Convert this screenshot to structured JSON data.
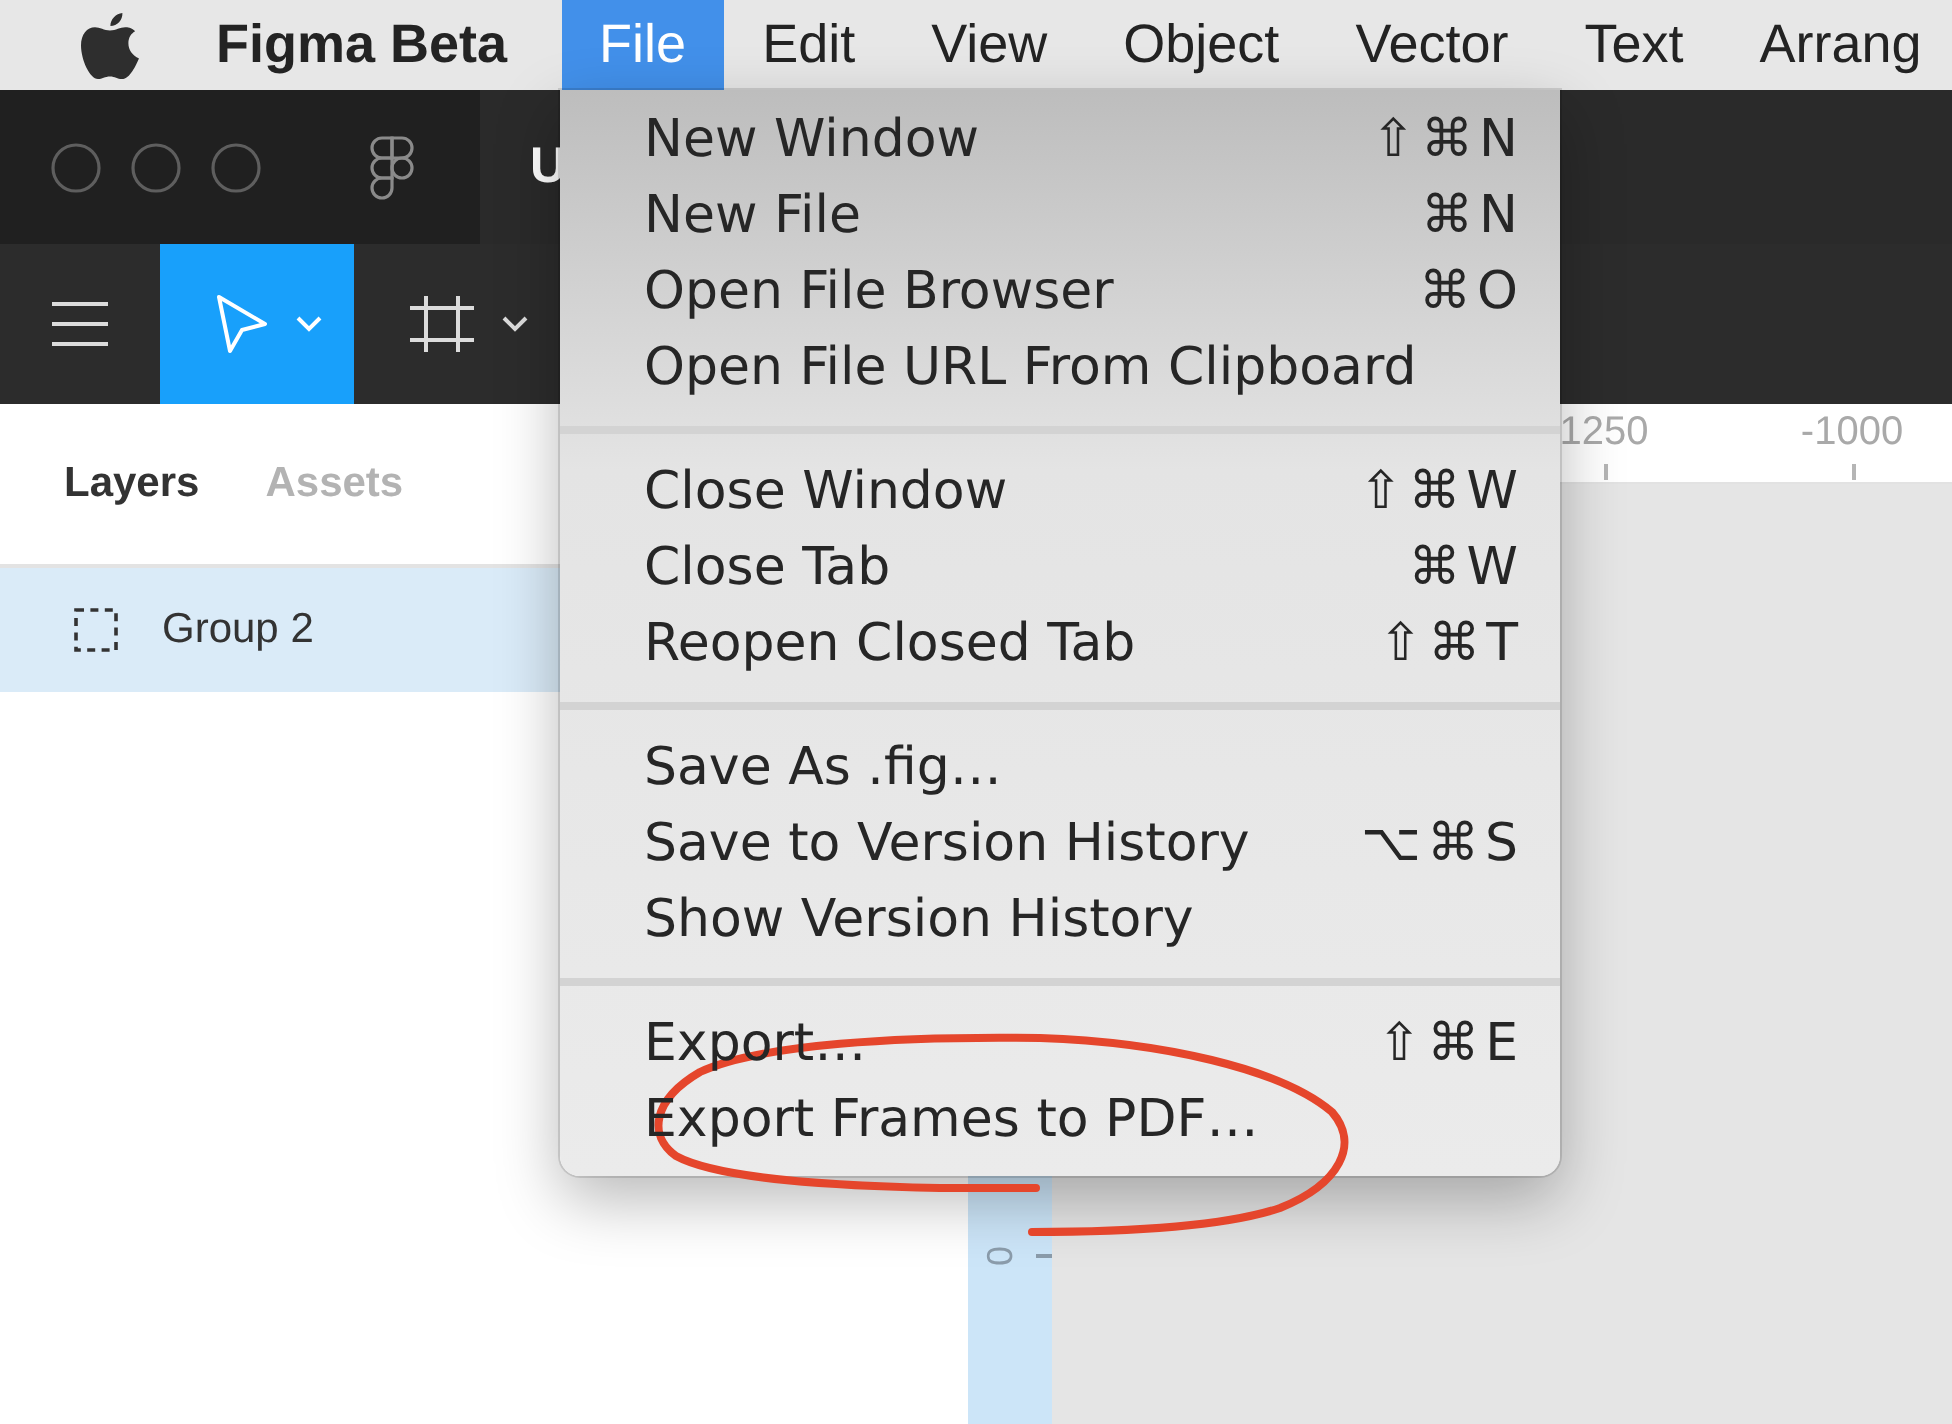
{
  "menu_bar": {
    "app_name": "Figma Beta",
    "menus": [
      {
        "label": "File",
        "selected": true
      },
      {
        "label": "Edit",
        "selected": false
      },
      {
        "label": "View",
        "selected": false
      },
      {
        "label": "Object",
        "selected": false
      },
      {
        "label": "Vector",
        "selected": false
      },
      {
        "label": "Text",
        "selected": false
      },
      {
        "label": "Arrang",
        "selected": false
      }
    ]
  },
  "window": {
    "tab_title": "U"
  },
  "toolbar": {
    "tools": [
      {
        "kind": "move",
        "selected": true
      },
      {
        "kind": "frame",
        "selected": false
      }
    ]
  },
  "layers_panel": {
    "tabs": [
      {
        "label": "Layers",
        "selected": true
      },
      {
        "label": "Assets",
        "selected": false
      }
    ],
    "layers": [
      {
        "name": "Group 2",
        "selected": true
      }
    ]
  },
  "canvas": {
    "top_ruler": [
      "1250",
      "-1000"
    ],
    "left_ruler": [
      "0"
    ]
  },
  "file_menu": {
    "sections": [
      {
        "items": [
          {
            "label": "New Window",
            "shortcut": "⇧⌘N"
          },
          {
            "label": "New File",
            "shortcut": "⌘N"
          },
          {
            "label": "Open File Browser",
            "shortcut": "⌘O"
          },
          {
            "label": "Open File URL From Clipboard"
          }
        ]
      },
      {
        "items": [
          {
            "label": "Close Window",
            "shortcut": "⇧⌘W"
          },
          {
            "label": "Close Tab",
            "shortcut": "⌘W"
          },
          {
            "label": "Reopen Closed Tab",
            "shortcut": "⇧⌘T"
          }
        ]
      },
      {
        "items": [
          {
            "label": "Save As .fig…"
          },
          {
            "label": "Save to Version History",
            "shortcut": "⌥⌘S"
          },
          {
            "label": "Show Version History"
          }
        ]
      },
      {
        "items": [
          {
            "label": "Export…",
            "shortcut": "⇧⌘E"
          },
          {
            "label": "Export Frames to PDF…"
          }
        ]
      }
    ]
  }
}
